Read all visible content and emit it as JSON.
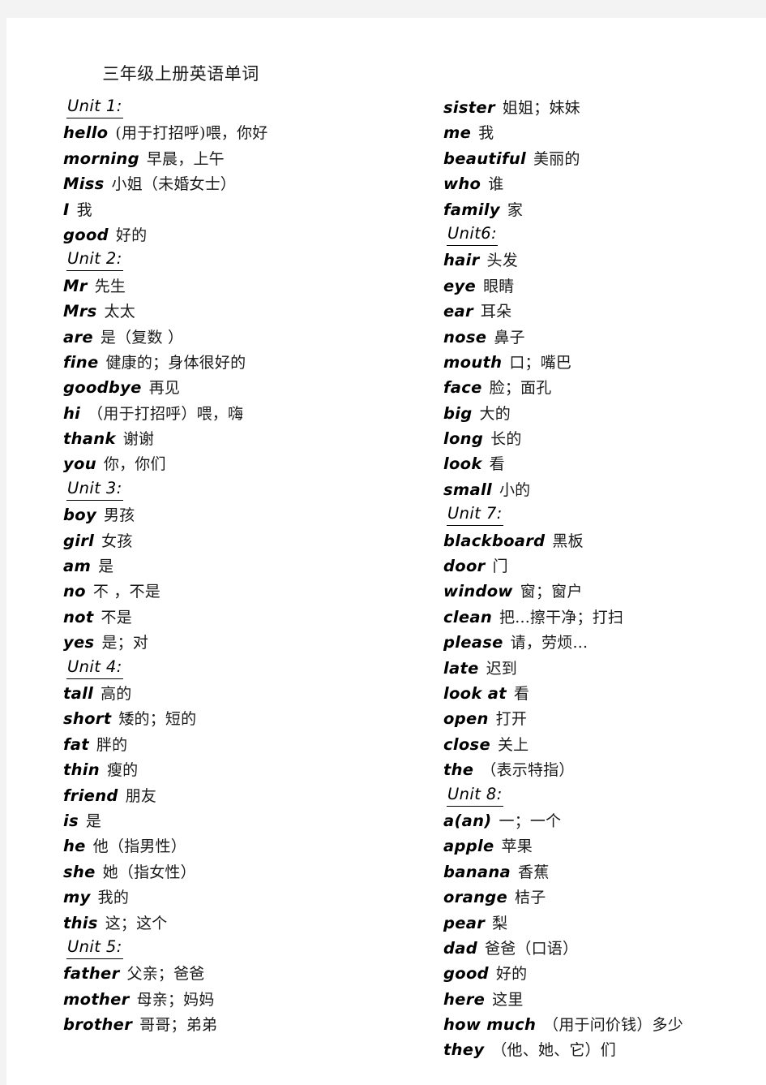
{
  "document": {
    "title": "三年级上册英语单词"
  },
  "columns": {
    "left": [
      {
        "type": "unit",
        "label": "Unit 1:"
      },
      {
        "type": "word",
        "en": "hello",
        "zh": "(用于打招呼)喂，你好"
      },
      {
        "type": "word",
        "en": "morning",
        "zh": "早晨，上午"
      },
      {
        "type": "word",
        "en": "Miss",
        "zh": "小姐（未婚女士）"
      },
      {
        "type": "word",
        "en": "I",
        "zh": "我"
      },
      {
        "type": "word",
        "en": "good",
        "zh": "好的"
      },
      {
        "type": "unit",
        "label": "Unit 2:"
      },
      {
        "type": "word",
        "en": "Mr",
        "zh": "先生"
      },
      {
        "type": "word",
        "en": "Mrs",
        "zh": "太太"
      },
      {
        "type": "word",
        "en": "are",
        "zh": "是（复数 ）"
      },
      {
        "type": "word",
        "en": "fine",
        "zh": "健康的；身体很好的"
      },
      {
        "type": "word",
        "en": "goodbye",
        "zh": "再见"
      },
      {
        "type": "word",
        "en": "hi",
        "zh": "（用于打招呼）喂，嗨"
      },
      {
        "type": "word",
        "en": "thank",
        "zh": "谢谢"
      },
      {
        "type": "word",
        "en": "you",
        "zh": "你，你们"
      },
      {
        "type": "unit",
        "label": "Unit 3:"
      },
      {
        "type": "word",
        "en": "boy",
        "zh": "男孩"
      },
      {
        "type": "word",
        "en": "girl",
        "zh": "女孩"
      },
      {
        "type": "word",
        "en": "am",
        "zh": "是"
      },
      {
        "type": "word",
        "en": "no",
        "zh": "不 ，不是"
      },
      {
        "type": "word",
        "en": "not",
        "zh": "不是"
      },
      {
        "type": "word",
        "en": "yes",
        "zh": "是；对"
      },
      {
        "type": "unit",
        "label": "Unit 4:"
      },
      {
        "type": "word",
        "en": "tall",
        "zh": "高的"
      },
      {
        "type": "word",
        "en": "short",
        "zh": "矮的；短的"
      },
      {
        "type": "word",
        "en": "fat",
        "zh": "胖的"
      },
      {
        "type": "word",
        "en": "thin",
        "zh": "瘦的"
      },
      {
        "type": "word",
        "en": "friend",
        "zh": "朋友"
      },
      {
        "type": "word",
        "en": "is",
        "zh": "是"
      },
      {
        "type": "word",
        "en": "he",
        "zh": "他（指男性）"
      },
      {
        "type": "word",
        "en": "she",
        "zh": "她（指女性）"
      },
      {
        "type": "word",
        "en": "my",
        "zh": "我的"
      },
      {
        "type": "word",
        "en": "this",
        "zh": "这；这个"
      },
      {
        "type": "unit",
        "label": "Unit 5:"
      },
      {
        "type": "word",
        "en": "father",
        "zh": "父亲；爸爸"
      },
      {
        "type": "word",
        "en": "mother",
        "zh": "母亲；妈妈"
      },
      {
        "type": "word",
        "en": "brother",
        "zh": "哥哥；弟弟"
      }
    ],
    "right": [
      {
        "type": "word",
        "en": "sister",
        "zh": "姐姐；妹妹"
      },
      {
        "type": "word",
        "en": "me",
        "zh": "我"
      },
      {
        "type": "word",
        "en": "beautiful",
        "zh": "美丽的"
      },
      {
        "type": "word",
        "en": "who",
        "zh": "谁"
      },
      {
        "type": "word",
        "en": "family",
        "zh": "家"
      },
      {
        "type": "unit",
        "label": "Unit6:"
      },
      {
        "type": "word",
        "en": "hair",
        "zh": "头发"
      },
      {
        "type": "word",
        "en": "eye",
        "zh": "眼睛"
      },
      {
        "type": "word",
        "en": "ear",
        "zh": "耳朵"
      },
      {
        "type": "word",
        "en": "nose",
        "zh": "鼻子"
      },
      {
        "type": "word",
        "en": "mouth",
        "zh": "口；嘴巴"
      },
      {
        "type": "word",
        "en": "face",
        "zh": "脸；面孔"
      },
      {
        "type": "word",
        "en": "big",
        "zh": "大的"
      },
      {
        "type": "word",
        "en": "long",
        "zh": "长的"
      },
      {
        "type": "word",
        "en": "look",
        "zh": "看"
      },
      {
        "type": "word",
        "en": "small",
        "zh": "小的"
      },
      {
        "type": "unit",
        "label": "Unit 7:"
      },
      {
        "type": "word",
        "en": "blackboard",
        "zh": "黑板"
      },
      {
        "type": "word",
        "en": "door",
        "zh": "门"
      },
      {
        "type": "word",
        "en": "window",
        "zh": "窗；窗户"
      },
      {
        "type": "word",
        "en": "clean",
        "zh": "把...擦干净；打扫"
      },
      {
        "type": "word",
        "en": "please",
        "zh": "请，劳烦..."
      },
      {
        "type": "word",
        "en": "late",
        "zh": "迟到"
      },
      {
        "type": "word",
        "en": "look at",
        "zh": "看"
      },
      {
        "type": "word",
        "en": "open",
        "zh": "打开"
      },
      {
        "type": "word",
        "en": "close",
        "zh": "关上"
      },
      {
        "type": "word",
        "en": "the",
        "zh": "（表示特指）"
      },
      {
        "type": "unit",
        "label": "Unit 8:"
      },
      {
        "type": "word",
        "en": "a(an)",
        "zh": "一；一个"
      },
      {
        "type": "word",
        "en": "apple",
        "zh": "苹果"
      },
      {
        "type": "word",
        "en": "banana",
        "zh": "香蕉"
      },
      {
        "type": "word",
        "en": "orange",
        "zh": "桔子"
      },
      {
        "type": "word",
        "en": "pear",
        "zh": "梨"
      },
      {
        "type": "word",
        "en": "dad",
        "zh": "爸爸（口语）"
      },
      {
        "type": "word",
        "en": "good",
        "zh": "好的"
      },
      {
        "type": "word",
        "en": "here",
        "zh": "这里"
      },
      {
        "type": "word",
        "en": "how much",
        "zh": "（用于问价钱）多少"
      },
      {
        "type": "word",
        "en": "they",
        "zh": "（他、她、它）们"
      }
    ]
  }
}
